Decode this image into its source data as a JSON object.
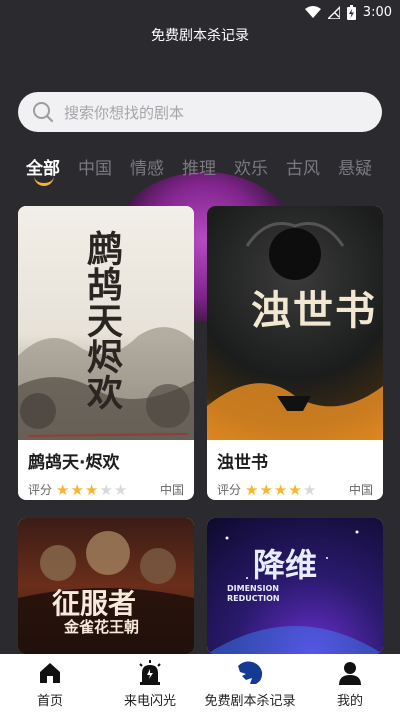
{
  "status_bar": {
    "time": "3:00",
    "wifi_icon": "wifi-icon",
    "signal_icon": "signal-off-icon",
    "battery_icon": "battery-charging-icon"
  },
  "header": {
    "title": "免费剧本杀记录"
  },
  "search": {
    "placeholder": "搜索你想找的剧本",
    "icon": "search-icon"
  },
  "tabs": [
    {
      "label": "全部",
      "active": true
    },
    {
      "label": "中国"
    },
    {
      "label": "情感"
    },
    {
      "label": "推理"
    },
    {
      "label": "欢乐"
    },
    {
      "label": "古风"
    },
    {
      "label": "悬疑"
    }
  ],
  "cards": [
    {
      "name": "鹧鸪天·烬欢",
      "rating_label": "评分",
      "stars": 3,
      "max_stars": 5,
      "region": "中国",
      "cover_text": "鹧鸪天烬欢"
    },
    {
      "name": "浊世书",
      "rating_label": "评分",
      "stars": 4,
      "max_stars": 5,
      "region": "中国",
      "cover_text": "浊世书"
    },
    {
      "name": "",
      "cover_text": "征服者",
      "cover_subtext": "金雀花王朝"
    },
    {
      "name": "",
      "cover_text": "降维",
      "cover_subtext": "DIMENSION REDUCTION"
    }
  ],
  "bottom_nav": [
    {
      "label": "首页",
      "icon": "home-icon"
    },
    {
      "label": "来电闪光",
      "icon": "alarm-flash-icon"
    },
    {
      "label": "免费剧本杀记录",
      "icon": "lion-icon"
    },
    {
      "label": "我的",
      "icon": "user-icon"
    }
  ],
  "colors": {
    "background": "#2b2a2f",
    "accent": "#f3b531",
    "star": "#f6b72e"
  }
}
